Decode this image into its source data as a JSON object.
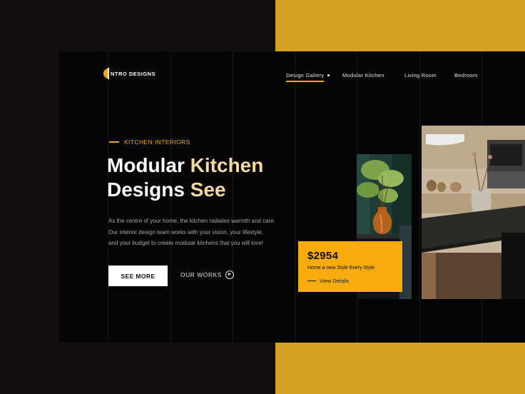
{
  "brand": {
    "logo_text": "NTRO DESIGNS"
  },
  "nav": {
    "items": [
      {
        "label": "Design Gallery",
        "active": true
      },
      {
        "label": "Modular Kitchen"
      },
      {
        "label": "Living Room"
      },
      {
        "label": "Bedroom"
      }
    ]
  },
  "hero": {
    "eyebrow": "KITCHEN INTERIORS",
    "title_line1_white": "Modular ",
    "title_line1_gold": "Kitchen",
    "title_line2_white": "Designs ",
    "title_line2_gold": "See",
    "paragraph_lines": [
      "As the centre of your home, the kitchen radiates warmth and care.",
      "Our interior design team works with your vision, your lifestyle,",
      "and your budget to create modular kitchens that you will love!"
    ],
    "primary_button": "SEE MORE",
    "secondary_button": "OUR WORKS"
  },
  "price_card": {
    "price": "$2954",
    "subtitle": "Home a new Style Every Style",
    "link": "View Details"
  },
  "colors": {
    "accent_gold": "#d6a022",
    "accent_orange": "#f3a81c",
    "panel_black": "#040404",
    "page_bg": "#120f0e",
    "title_gold": "#f6d9a2",
    "card_yellow": "#f7ab0d"
  },
  "icons": {
    "logo": "half-circle-logo-icon",
    "play": "play-circle-icon"
  }
}
